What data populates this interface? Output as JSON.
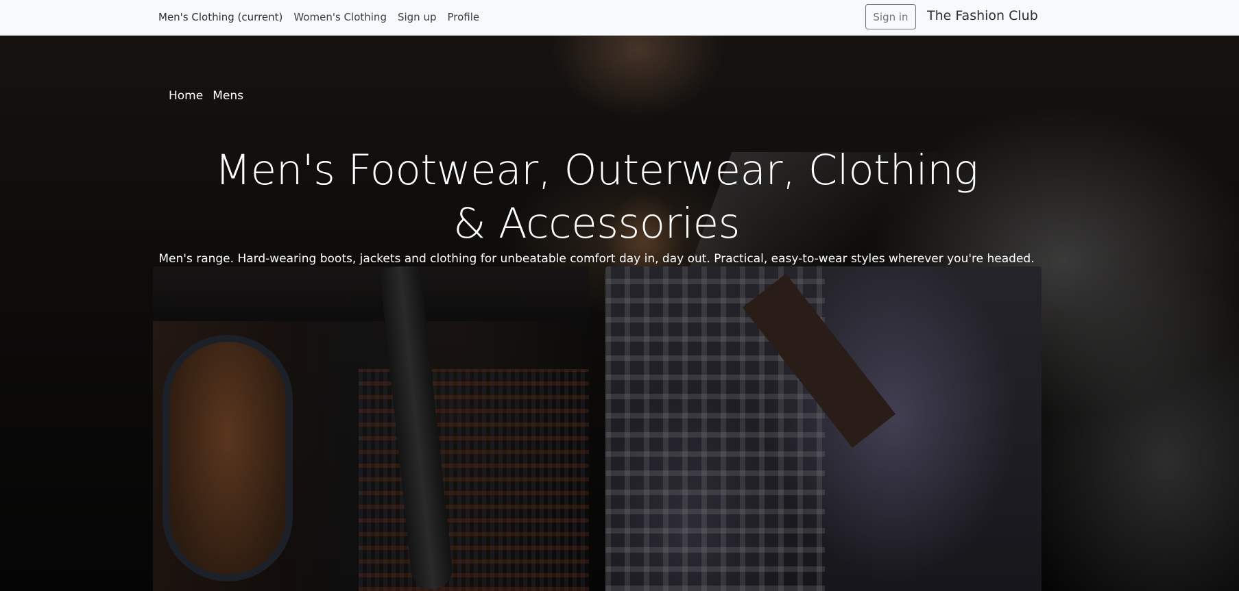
{
  "navbar": {
    "links": [
      {
        "label": "Men's Clothing (current)"
      },
      {
        "label": "Women's Clothing"
      },
      {
        "label": "Sign up"
      },
      {
        "label": "Profile"
      }
    ],
    "signin_label": "Sign in",
    "brand": "The Fashion Club"
  },
  "breadcrumb": {
    "items": [
      "Home",
      "Mens"
    ]
  },
  "hero": {
    "title": "Men's Footwear, Outerwear, Clothing & Accessories",
    "subtitle": "Men's range. Hard-wearing boots, jackets and clothing for unbeatable comfort day in, day out. Practical, easy-to-wear styles wherever you're headed."
  }
}
